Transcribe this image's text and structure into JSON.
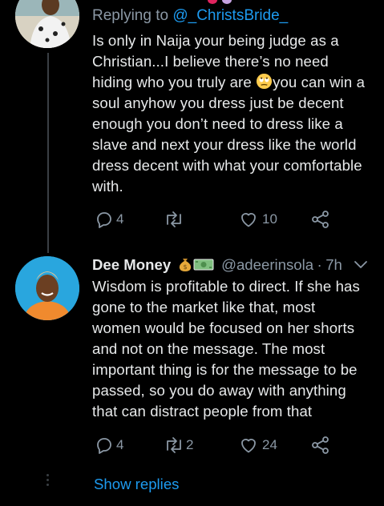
{
  "tweet1": {
    "reply_prefix": "Replying to ",
    "reply_handle": "@_ChristsBride_",
    "lines": [
      "Is only in Naija your being judge as a",
      "Christian...I believe there’s no need",
      "hiding who you truly are",
      "you can win a",
      "soul anyhow you dress just be decent",
      "enough you don’t need to dress like a",
      "slave and next your dress like the world",
      "dress decent with what your comfortable",
      "with."
    ],
    "emoji": "rolling-eyes-face",
    "replies": "4",
    "retweets": "",
    "likes": "10"
  },
  "tweet2": {
    "display_name": "Dee Money",
    "badge_emojis": [
      "money-bag-icon",
      "dollar-banknote-icon"
    ],
    "handle": "@adeerinsola",
    "separator": "·",
    "time": "7h",
    "lines": [
      "Wisdom is profitable to direct. If she has",
      "gone to the market like that, most",
      "women would be focused on her shorts",
      "and not on the message. The most",
      "important thing is for the message to be",
      "passed, so you do away with anything",
      "that can distract people from that"
    ],
    "replies": "4",
    "retweets": "2",
    "likes": "24"
  },
  "show_replies": "Show replies",
  "colors": {
    "background": "#000000",
    "text": "#e7e9ea",
    "secondary": "#8b98a5",
    "link": "#1d9bf0"
  }
}
